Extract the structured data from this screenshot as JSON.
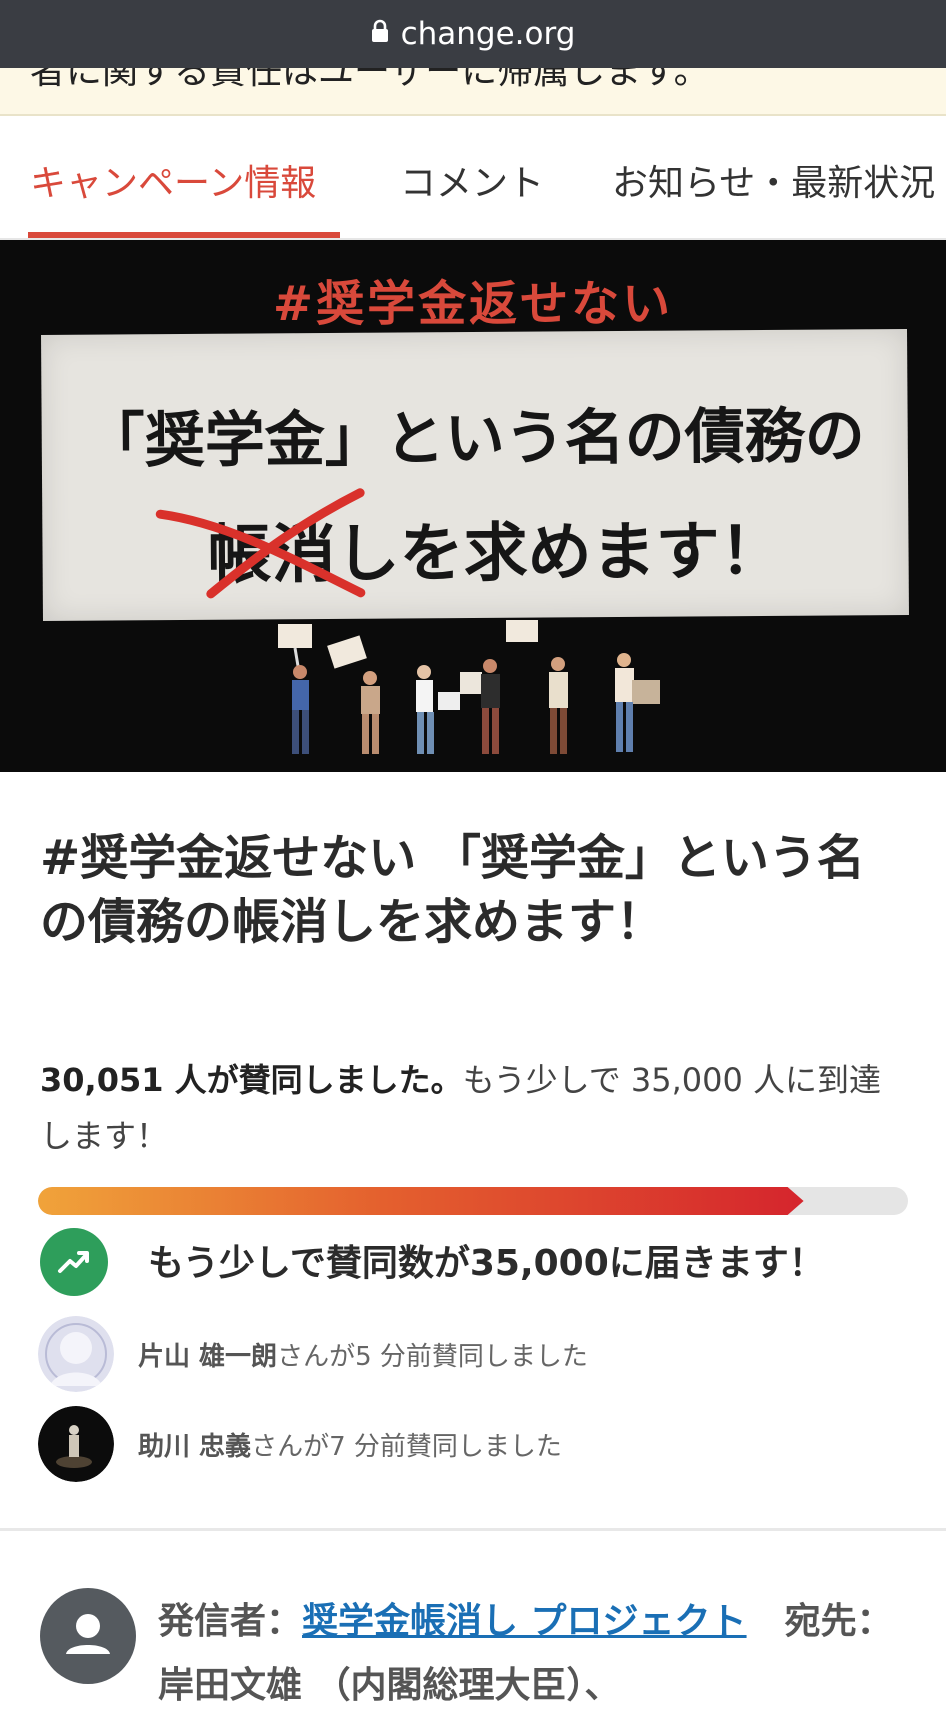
{
  "browser": {
    "url": "change.org"
  },
  "banner": {
    "text": "者に関する責任はユーザーに帰属します。"
  },
  "tabs": [
    {
      "label": "キャンペーン情報",
      "active": true
    },
    {
      "label": "コメント",
      "active": false
    },
    {
      "label": "お知らせ・最新状況",
      "active": false
    }
  ],
  "hero": {
    "hashtag": "#奨学金返せない",
    "line1": "「奨学金」という名の債務の",
    "line2": "帳消しを求めます！"
  },
  "campaign": {
    "title": "#奨学金返せない 「奨学金」という名の債務の帳消しを求めます！",
    "signed_strong": "30,051 人が賛同しました。",
    "signed_rest": "もう少しで 35,000 人に到達します！",
    "signatures": 30051,
    "goal": 35000,
    "progress_fraction": 0.88,
    "milestone_text": "もう少しで賛同数が35,000に届きます！"
  },
  "recent_signers": [
    {
      "name": "片山 雄一朗",
      "suffix": "さんが5 分前賛同しました",
      "avatar": "default-avatar"
    },
    {
      "name": "助川 忠義",
      "suffix": "さんが7 分前賛同しました",
      "avatar": "photo-avatar"
    }
  ],
  "creator": {
    "from_label": "発信者：",
    "from_name": "奨学金帳消し プロジェクト",
    "to_label": "宛先：",
    "to_name": "岸田文雄 （内閣総理大臣）、"
  },
  "colors": {
    "accent": "#d9493b",
    "green": "#2e9e5b",
    "link": "#1a6fb5"
  }
}
